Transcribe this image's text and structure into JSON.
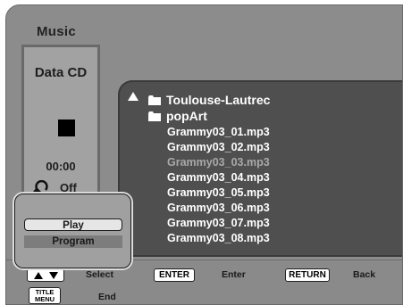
{
  "header": {
    "title": "Music"
  },
  "status_panel": {
    "disc_type": "Data CD",
    "playback_state_icon": "stop-icon",
    "time": "00:00",
    "repeat_icon": "repeat-icon",
    "repeat_mode": "Off"
  },
  "file_browser": {
    "up_icon": "up-arrow-icon",
    "parent_folder": "Toulouse-Lautrec",
    "current_folder": "popArt",
    "files": [
      {
        "name": "Grammy03_01.mp3",
        "dimmed": false
      },
      {
        "name": "Grammy03_02.mp3",
        "dimmed": false
      },
      {
        "name": "Grammy03_03.mp3",
        "dimmed": true
      },
      {
        "name": "Grammy03_04.mp3",
        "dimmed": false
      },
      {
        "name": "Grammy03_05.mp3",
        "dimmed": false
      },
      {
        "name": "Grammy03_06.mp3",
        "dimmed": false
      },
      {
        "name": "Grammy03_07.mp3",
        "dimmed": false
      },
      {
        "name": "Grammy03_08.mp3",
        "dimmed": false
      }
    ]
  },
  "popup_menu": {
    "items": [
      {
        "label": "Play",
        "state": "highlighted"
      },
      {
        "label": "Program",
        "state": "normal"
      }
    ]
  },
  "guide_bar": {
    "arrow_keys_hint": "Select",
    "enter_key": "ENTER",
    "enter_hint": "Enter",
    "return_key": "RETURN",
    "return_hint": "Back",
    "title_menu_key_line1": "TITLE",
    "title_menu_key_line2": "MENU",
    "title_menu_hint": "End"
  },
  "colors": {
    "screen_bg": "#8c8c8c",
    "file_panel_bg": "#4f4f4f",
    "file_text": "#ffffff",
    "dimmed_file_text": "#a8a8a8",
    "highlight_bg": "#e6e6e6"
  }
}
